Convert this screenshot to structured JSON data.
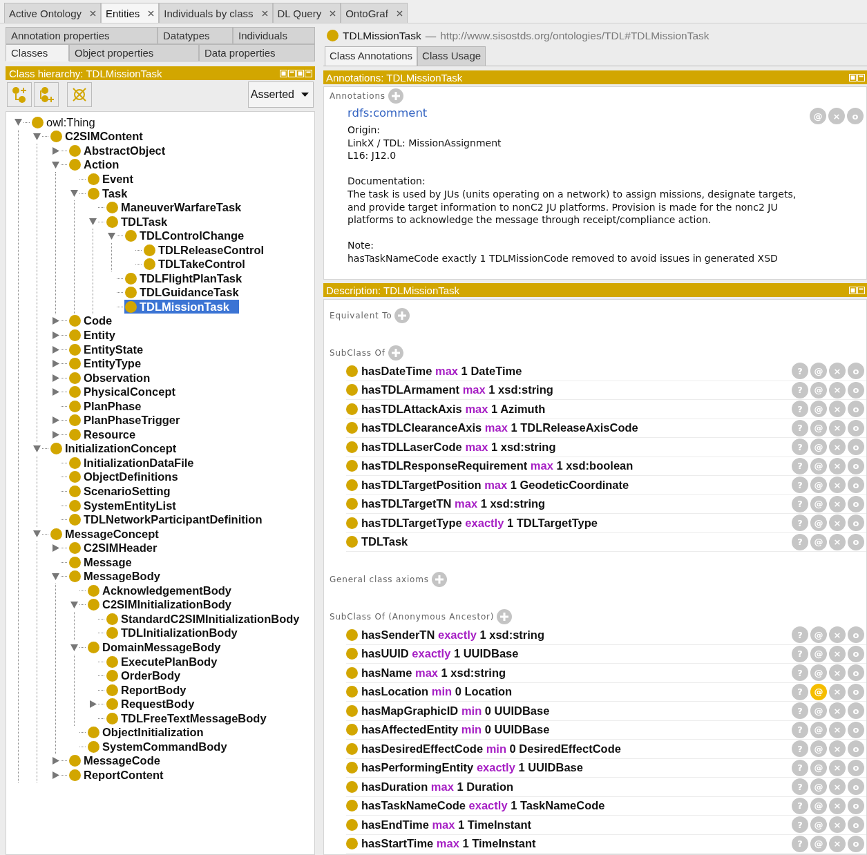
{
  "tabs": [
    {
      "label": "Active Ontology",
      "selected": false
    },
    {
      "label": "Entities",
      "selected": true
    },
    {
      "label": "Individuals by class",
      "selected": false
    },
    {
      "label": "DL Query",
      "selected": false
    },
    {
      "label": "OntoGraf",
      "selected": false
    }
  ],
  "entity_tabs": {
    "rows": [
      [
        {
          "label": "Annotation properties",
          "selected": false
        },
        {
          "label": "Datatypes",
          "selected": false
        },
        {
          "label": "Individuals",
          "selected": false
        }
      ],
      [
        {
          "label": "Classes",
          "selected": true
        },
        {
          "label": "Object properties",
          "selected": false
        },
        {
          "label": "Data properties",
          "selected": false
        }
      ]
    ]
  },
  "class_hierarchy": {
    "title": "Class hierarchy: TDLMissionTask",
    "view_menu": "Asserted",
    "tree": [
      {
        "label": "owl:Thing",
        "bold": false,
        "selected": false,
        "expanded": true,
        "children": [
          {
            "label": "C2SIMContent",
            "bold": true,
            "selected": false,
            "expanded": true,
            "children": [
              {
                "label": "AbstractObject",
                "bold": true,
                "selected": false,
                "expanded": false
              },
              {
                "label": "Action",
                "bold": true,
                "selected": false,
                "expanded": true,
                "children": [
                  {
                    "label": "Event",
                    "bold": true,
                    "selected": false
                  },
                  {
                    "label": "Task",
                    "bold": true,
                    "selected": false,
                    "expanded": true,
                    "children": [
                      {
                        "label": "ManeuverWarfareTask",
                        "bold": true,
                        "selected": false
                      },
                      {
                        "label": "TDLTask",
                        "bold": true,
                        "selected": false,
                        "expanded": true,
                        "children": [
                          {
                            "label": "TDLControlChange",
                            "bold": true,
                            "selected": false,
                            "expanded": true,
                            "children": [
                              {
                                "label": "TDLReleaseControl",
                                "bold": true,
                                "selected": false
                              },
                              {
                                "label": "TDLTakeControl",
                                "bold": true,
                                "selected": false
                              }
                            ]
                          },
                          {
                            "label": "TDLFlightPlanTask",
                            "bold": true,
                            "selected": false
                          },
                          {
                            "label": "TDLGuidanceTask",
                            "bold": true,
                            "selected": false
                          },
                          {
                            "label": "TDLMissionTask",
                            "bold": true,
                            "selected": true
                          }
                        ]
                      }
                    ]
                  }
                ]
              },
              {
                "label": "Code",
                "bold": true,
                "selected": false,
                "expanded": false
              },
              {
                "label": "Entity",
                "bold": true,
                "selected": false,
                "expanded": false
              },
              {
                "label": "EntityState",
                "bold": true,
                "selected": false,
                "expanded": false
              },
              {
                "label": "EntityType",
                "bold": true,
                "selected": false,
                "expanded": false
              },
              {
                "label": "Observation",
                "bold": true,
                "selected": false,
                "expanded": false
              },
              {
                "label": "PhysicalConcept",
                "bold": true,
                "selected": false,
                "expanded": false
              },
              {
                "label": "PlanPhase",
                "bold": true,
                "selected": false
              },
              {
                "label": "PlanPhaseTrigger",
                "bold": true,
                "selected": false,
                "expanded": false
              },
              {
                "label": "Resource",
                "bold": true,
                "selected": false,
                "expanded": false
              }
            ]
          },
          {
            "label": "InitializationConcept",
            "bold": true,
            "selected": false,
            "expanded": true,
            "children": [
              {
                "label": "InitializationDataFile",
                "bold": true,
                "selected": false
              },
              {
                "label": "ObjectDefinitions",
                "bold": true,
                "selected": false
              },
              {
                "label": "ScenarioSetting",
                "bold": true,
                "selected": false
              },
              {
                "label": "SystemEntityList",
                "bold": true,
                "selected": false
              },
              {
                "label": "TDLNetworkParticipantDefinition",
                "bold": true,
                "selected": false
              }
            ]
          },
          {
            "label": "MessageConcept",
            "bold": true,
            "selected": false,
            "expanded": true,
            "children": [
              {
                "label": "C2SIMHeader",
                "bold": true,
                "selected": false,
                "expanded": false
              },
              {
                "label": "Message",
                "bold": true,
                "selected": false
              },
              {
                "label": "MessageBody",
                "bold": true,
                "selected": false,
                "expanded": true,
                "children": [
                  {
                    "label": "AcknowledgementBody",
                    "bold": true,
                    "selected": false
                  },
                  {
                    "label": "C2SIMInitializationBody",
                    "bold": true,
                    "selected": false,
                    "expanded": true,
                    "children": [
                      {
                        "label": "StandardC2SIMInitializationBody",
                        "bold": true,
                        "selected": false
                      },
                      {
                        "label": "TDLInitializationBody",
                        "bold": true,
                        "selected": false
                      }
                    ]
                  },
                  {
                    "label": "DomainMessageBody",
                    "bold": true,
                    "selected": false,
                    "expanded": true,
                    "children": [
                      {
                        "label": "ExecutePlanBody",
                        "bold": true,
                        "selected": false
                      },
                      {
                        "label": "OrderBody",
                        "bold": true,
                        "selected": false
                      },
                      {
                        "label": "ReportBody",
                        "bold": true,
                        "selected": false
                      },
                      {
                        "label": "RequestBody",
                        "bold": true,
                        "selected": false,
                        "expanded": false
                      },
                      {
                        "label": "TDLFreeTextMessageBody",
                        "bold": true,
                        "selected": false
                      }
                    ]
                  },
                  {
                    "label": "ObjectInitialization",
                    "bold": true,
                    "selected": false
                  },
                  {
                    "label": "SystemCommandBody",
                    "bold": true,
                    "selected": false
                  }
                ]
              },
              {
                "label": "MessageCode",
                "bold": true,
                "selected": false,
                "expanded": false
              },
              {
                "label": "ReportContent",
                "bold": true,
                "selected": false,
                "expanded": false
              }
            ]
          }
        ]
      }
    ]
  },
  "entity": {
    "name": "TDLMissionTask",
    "separator": "—",
    "iri": "http://www.sisostds.org/ontologies/TDL#TDLMissionTask"
  },
  "view_tabs": [
    {
      "label": "Class Annotations",
      "selected": true
    },
    {
      "label": "Class Usage",
      "selected": false
    }
  ],
  "annotations": {
    "title": "Annotations: TDLMissionTask",
    "section": "Annotations",
    "items": [
      {
        "property": "rdfs:comment",
        "value": "Origin:\nLinkX / TDL: MissionAssignment\nL16: J12.0\n\nDocumentation:\nThe task is used by JUs (units operating on a network) to assign missions, designate targets, and provide target information to nonC2 JU platforms. Provision is made for the nonc2 JU platforms to acknowledge the message through receipt/compliance action.\n\nNote:\nhasTaskNameCode exactly 1 TDLMissionCode removed to avoid issues in generated XSD",
        "actions": [
          "@",
          "×",
          "o"
        ]
      }
    ]
  },
  "description": {
    "title": "Description: TDLMissionTask",
    "sections": [
      {
        "title": "Equivalent To"
      },
      {
        "title": "SubClass Of",
        "items": [
          {
            "kind": "restriction",
            "property": "hasDateTime",
            "restriction": "max",
            "cardinality": "1",
            "filler": "DateTime",
            "annotated": false,
            "actions": [
              "?",
              "@",
              "×",
              "o"
            ]
          },
          {
            "kind": "restriction",
            "property": "hasTDLArmament",
            "restriction": "max",
            "cardinality": "1",
            "filler": "xsd:string",
            "annotated": false,
            "actions": [
              "?",
              "@",
              "×",
              "o"
            ]
          },
          {
            "kind": "restriction",
            "property": "hasTDLAttackAxis",
            "restriction": "max",
            "cardinality": "1",
            "filler": "Azimuth",
            "annotated": false,
            "actions": [
              "?",
              "@",
              "×",
              "o"
            ]
          },
          {
            "kind": "restriction",
            "property": "hasTDLClearanceAxis",
            "restriction": "max",
            "cardinality": "1",
            "filler": "TDLReleaseAxisCode",
            "annotated": false,
            "actions": [
              "?",
              "@",
              "×",
              "o"
            ]
          },
          {
            "kind": "restriction",
            "property": "hasTDLLaserCode",
            "restriction": "max",
            "cardinality": "1",
            "filler": "xsd:string",
            "annotated": false,
            "actions": [
              "?",
              "@",
              "×",
              "o"
            ]
          },
          {
            "kind": "restriction",
            "property": "hasTDLResponseRequirement",
            "restriction": "max",
            "cardinality": "1",
            "filler": "xsd:boolean",
            "annotated": false,
            "actions": [
              "?",
              "@",
              "×",
              "o"
            ]
          },
          {
            "kind": "restriction",
            "property": "hasTDLTargetPosition",
            "restriction": "max",
            "cardinality": "1",
            "filler": "GeodeticCoordinate",
            "annotated": false,
            "actions": [
              "?",
              "@",
              "×",
              "o"
            ]
          },
          {
            "kind": "restriction",
            "property": "hasTDLTargetTN",
            "restriction": "max",
            "cardinality": "1",
            "filler": "xsd:string",
            "annotated": false,
            "actions": [
              "?",
              "@",
              "×",
              "o"
            ]
          },
          {
            "kind": "restriction",
            "property": "hasTDLTargetType",
            "restriction": "exactly",
            "cardinality": "1",
            "filler": "TDLTargetType",
            "annotated": false,
            "actions": [
              "?",
              "@",
              "×",
              "o"
            ]
          },
          {
            "kind": "class",
            "class": "TDLTask",
            "annotated": false,
            "actions": [
              "?",
              "@",
              "×",
              "o"
            ]
          }
        ]
      },
      {
        "title": "General class axioms"
      },
      {
        "title": "SubClass Of (Anonymous Ancestor)",
        "items": [
          {
            "kind": "restriction",
            "property": "hasSenderTN",
            "restriction": "exactly",
            "cardinality": "1",
            "filler": "xsd:string",
            "annotated": false,
            "actions": [
              "?",
              "@",
              "×",
              "o"
            ]
          },
          {
            "kind": "restriction",
            "property": "hasUUID",
            "restriction": "exactly",
            "cardinality": "1",
            "filler": "UUIDBase",
            "annotated": false,
            "actions": [
              "?",
              "@",
              "×",
              "o"
            ]
          },
          {
            "kind": "restriction",
            "property": "hasName",
            "restriction": "max",
            "cardinality": "1",
            "filler": "xsd:string",
            "annotated": false,
            "actions": [
              "?",
              "@",
              "×",
              "o"
            ]
          },
          {
            "kind": "restriction",
            "property": "hasLocation",
            "restriction": "min",
            "cardinality": "0",
            "filler": "Location",
            "annotated": true,
            "actions": [
              "?",
              "@",
              "×",
              "o"
            ]
          },
          {
            "kind": "restriction",
            "property": "hasMapGraphicID",
            "restriction": "min",
            "cardinality": "0",
            "filler": "UUIDBase",
            "annotated": false,
            "actions": [
              "?",
              "@",
              "×",
              "o"
            ]
          },
          {
            "kind": "restriction",
            "property": "hasAffectedEntity",
            "restriction": "min",
            "cardinality": "0",
            "filler": "UUIDBase",
            "annotated": false,
            "actions": [
              "?",
              "@",
              "×",
              "o"
            ]
          },
          {
            "kind": "restriction",
            "property": "hasDesiredEffectCode",
            "restriction": "min",
            "cardinality": "0",
            "filler": "DesiredEffectCode",
            "annotated": false,
            "actions": [
              "?",
              "@",
              "×",
              "o"
            ]
          },
          {
            "kind": "restriction",
            "property": "hasPerformingEntity",
            "restriction": "exactly",
            "cardinality": "1",
            "filler": "UUIDBase",
            "annotated": false,
            "actions": [
              "?",
              "@",
              "×",
              "o"
            ]
          },
          {
            "kind": "restriction",
            "property": "hasDuration",
            "restriction": "max",
            "cardinality": "1",
            "filler": "Duration",
            "annotated": false,
            "actions": [
              "?",
              "@",
              "×",
              "o"
            ]
          },
          {
            "kind": "restriction",
            "property": "hasTaskNameCode",
            "restriction": "exactly",
            "cardinality": "1",
            "filler": "TaskNameCode",
            "annotated": false,
            "actions": [
              "?",
              "@",
              "×",
              "o"
            ]
          },
          {
            "kind": "restriction",
            "property": "hasEndTime",
            "restriction": "max",
            "cardinality": "1",
            "filler": "TimeInstant",
            "annotated": false,
            "actions": [
              "?",
              "@",
              "×",
              "o"
            ]
          },
          {
            "kind": "restriction",
            "property": "hasStartTime",
            "restriction": "max",
            "cardinality": "1",
            "filler": "TimeInstant",
            "annotated": false,
            "actions": [
              "?",
              "@",
              "×",
              "o"
            ]
          }
        ]
      }
    ]
  }
}
